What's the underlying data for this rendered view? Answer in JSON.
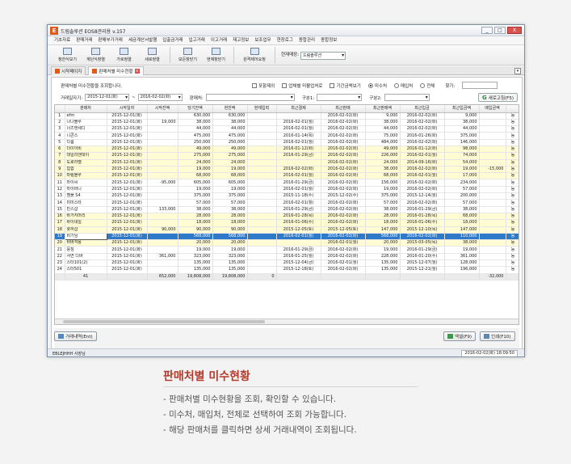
{
  "window": {
    "app_title": "드림솔루션 EOS8관리용 v.157",
    "buttons": [
      "_",
      "□",
      "X"
    ]
  },
  "menu": [
    "기초자료",
    "판매거래",
    "판매부가거래",
    "세금계산서발행",
    "입출금거래",
    "입고거래",
    "이고거래",
    "재고정보",
    "보조업무",
    "현장로그",
    "종합관리",
    "종합정보"
  ],
  "toolbar": {
    "buttons": [
      "청한식보기",
      "계단식창열",
      "가로정렬",
      "세로정렬",
      "모든창닫기",
      "현재창닫기",
      "원격제어요청"
    ],
    "shop_label": "현재매장:",
    "shop_value": "드림솔루션"
  },
  "tabs": [
    {
      "label": "시작페이지",
      "active": false
    },
    {
      "label": "판매처별 미수현황",
      "active": true
    }
  ],
  "filters": {
    "description": "판매처별 미수현황을 조회합니다.",
    "options": [
      "포함제외",
      "업체별 미활업처로",
      "기간금액보기"
    ],
    "radios": [
      "미수처",
      "매입처",
      "전체"
    ],
    "search_label": "찾기:",
    "period_label": "거래일자기:",
    "date_from": "2015-12-01(화)",
    "date_sep": "~",
    "date_to": "2016-02-02(화)",
    "vendor_label": "판매처:",
    "gubun1_label": "구분1:",
    "gubun2_label": "구분2:",
    "refresh_label": "새로고침(F5)"
  },
  "table": {
    "headers": [
      "",
      "판매처",
      "시작일자",
      "시작잔액",
      "당기잔액",
      "현잔액",
      "현재입력",
      "최근결제",
      "최근판매",
      "최근판매액",
      "최근입금",
      "최근입금액",
      "매입금액"
    ],
    "rows": [
      [
        "1",
        "efm",
        "2015-12-01(화)",
        "",
        "630,000",
        "630,000",
        "",
        "",
        "2016-02-02(화)",
        "9,000",
        "2016-02-02(화)",
        "9,000",
        "",
        "n"
      ],
      [
        "2",
        "나나블루",
        "2015-12-01(화)",
        "19,000",
        "38,000",
        "38,000",
        "",
        "2016-02-01(월)",
        "2016-02-02(화)",
        "38,000",
        "2016-02-02(화)",
        "38,000",
        "",
        "n"
      ],
      [
        "3",
        "너즈앤세디",
        "2015-12-01(화)",
        "",
        "44,000",
        "44,000",
        "",
        "2016-02-01(월)",
        "2016-02-02(화)",
        "44,000",
        "2016-02-02(화)",
        "44,000",
        "",
        "n"
      ],
      [
        "4",
        "니콘스",
        "2015-12-01(화)",
        "",
        "475,000",
        "475,000",
        "",
        "2016-01-14(목)",
        "2016-02-02(화)",
        "75,000",
        "2016-01-26(화)",
        "375,000",
        "",
        "n"
      ],
      [
        "5",
        "다룸",
        "2015-12-01(화)",
        "",
        "250,000",
        "250,000",
        "",
        "2016-02-01(월)",
        "2016-02-02(화)",
        "484,000",
        "2016-02-02(화)",
        "146,000",
        "",
        "n"
      ],
      [
        "6",
        "더이이비",
        "2015-12-01(화)",
        "",
        "49,000",
        "49,000",
        "",
        "2016-01-12(화)",
        "2016-02-02(화)",
        "49,000",
        "2016-01-12(화)",
        "98,000",
        "",
        "y"
      ],
      [
        "7",
        "데일리앤데이",
        "2015-12-01(화)",
        "",
        "275,000",
        "275,000",
        "",
        "2016-01-29(금)",
        "2016-02-02(화)",
        "226,000",
        "2016-02-01(월)",
        "74,000",
        "",
        "y"
      ],
      [
        "8",
        "도로라벨",
        "2015-12-01(화)",
        "",
        "24,000",
        "24,000",
        "",
        "",
        "2016-02-02(화)",
        "24,000",
        "2014-09-16(화)",
        "54,000",
        "",
        "y"
      ],
      [
        "9",
        "힙합",
        "2015-12-01(화)",
        "",
        "19,000",
        "19,000",
        "",
        "2016-02-02(화)",
        "2016-02-02(화)",
        "38,000",
        "2016-02-02(화)",
        "19,000",
        "-15,000",
        "y"
      ],
      [
        "10",
        "마링블루",
        "2015-12-01(화)",
        "",
        "68,000",
        "68,000",
        "",
        "2016-02-01(월)",
        "2016-02-02(화)",
        "68,000",
        "2016-02-01(월)",
        "17,000",
        "",
        "y"
      ],
      [
        "11",
        "마이씨",
        "2015-12-01(화)",
        "-95,000",
        "605,000",
        "605,000",
        "",
        "2016-01-29(금)",
        "2016-02-02(화)",
        "156,000",
        "2016-02-02(화)",
        "234,000",
        "",
        "n"
      ],
      [
        "12",
        "마이바니",
        "2015-12-01(화)",
        "",
        "19,000",
        "19,000",
        "",
        "2016-02-01(월)",
        "2016-02-02(화)",
        "19,000",
        "2016-02-02(화)",
        "57,000",
        "",
        "n"
      ],
      [
        "13",
        "멤플 S4",
        "2015-12-01(화)",
        "",
        "375,000",
        "375,000",
        "",
        "2015-11-18(수)",
        "2015-12-02(수)",
        "375,000",
        "2015-12-14(월)",
        "200,000",
        "",
        "n"
      ],
      [
        "14",
        "미미스타",
        "2015-12-01(화)",
        "",
        "57,000",
        "57,000",
        "",
        "2016-02-01(월)",
        "2016-02-02(화)",
        "57,000",
        "2016-02-02(화)",
        "57,000",
        "",
        "n"
      ],
      [
        "15",
        "민스샵",
        "2015-12-01(화)",
        "133,000",
        "38,000",
        "38,000",
        "",
        "2016-01-29(금)",
        "2016-02-02(화)",
        "38,000",
        "2016-01-29(금)",
        "38,000",
        "",
        "n"
      ],
      [
        "16",
        "바가지머리",
        "2015-12-01(화)",
        "",
        "28,000",
        "28,000",
        "",
        "2016-01-28(목)",
        "2016-02-02(화)",
        "28,000",
        "2016-01-28(목)",
        "68,000",
        "",
        "y"
      ],
      [
        "17",
        "바이네일",
        "2015-12-01(화)",
        "",
        "18,000",
        "18,000",
        "",
        "2016-01-06(수)",
        "2016-02-02(화)",
        "18,000",
        "2016-01-06(수)",
        "18,000",
        "",
        "y"
      ],
      [
        "18",
        "롯하샵",
        "2015-12-01(화)",
        "90,000",
        "90,000",
        "90,000",
        "",
        "2015-12-05(토)",
        "2015-12-05(토)",
        "147,000",
        "2015-12-10(목)",
        "147,000",
        "",
        "y"
      ],
      [
        "19",
        "비기님",
        "2015-12-01(화)",
        "",
        "568,000",
        "568,000",
        "",
        "2016-02-01(월)",
        "2016-02-02(화)",
        "568,000",
        "2016-02-02(화)",
        "110,000",
        "",
        "sel"
      ],
      [
        "20",
        "비바걱몽",
        "2015-12-01(화)",
        "",
        "20,000",
        "20,000",
        "",
        "",
        "2016-02-01(월)",
        "20,000",
        "2015-03-05(목)",
        "38,000",
        "",
        "y"
      ],
      [
        "21",
        "뭉칭",
        "2015-12-01(화)",
        "",
        "19,000",
        "19,000",
        "",
        "2016-01-29(금)",
        "2016-02-02(화)",
        "19,000",
        "2016-01-29(금)",
        "19,000",
        "",
        "n"
      ],
      [
        "22",
        "서연 디바",
        "2015-12-01(화)",
        "361,000",
        "323,000",
        "323,000",
        "",
        "2016-01-25(월)",
        "2016-02-02(화)",
        "228,000",
        "2016-01-20(수)",
        "361,000",
        "",
        "n"
      ],
      [
        "23",
        "스타101(2)",
        "2015-12-01(화)",
        "",
        "135,000",
        "135,000",
        "",
        "2015-12-04(금)",
        "2016-02-01(월)",
        "135,000",
        "2015-12-07(월)",
        "128,000",
        "",
        "n"
      ],
      [
        "24",
        "스타501",
        "2015-12-01(화)",
        "",
        "135,000",
        "135,000",
        "",
        "2015-12-18(토)",
        "2016-02-02(화)",
        "135,000",
        "2015-12-21(월)",
        "196,000",
        "",
        "n"
      ]
    ],
    "total": [
      "",
      "41",
      "",
      "652,000",
      "19,808,000",
      "19,808,000",
      "0",
      "",
      "",
      "",
      "",
      "",
      "-32,000"
    ]
  },
  "bottom": {
    "detail_button": "거래내역(Ent)",
    "excel_button": "엑셀(F9)",
    "print_button": "인쇄(F10)"
  },
  "status": {
    "user": "EBLEJHHH  사장님",
    "datetime": "2016-02-02(화) 18:09:50"
  },
  "caption": {
    "title": "판매처별 미수현황",
    "lines": [
      "- 판매처별 미수현황을 조회, 확인할 수 있습니다.",
      "- 미수처, 매입처, 전체로 선택하여 조회 가능합니다.",
      "- 해당 판매처를 클릭하면 상세 거래내역이 조회됩니다."
    ]
  },
  "colors": {
    "accent": "#2f79c9",
    "highlight_row": "#fffbd2",
    "caption_title": "#b63a2b"
  }
}
